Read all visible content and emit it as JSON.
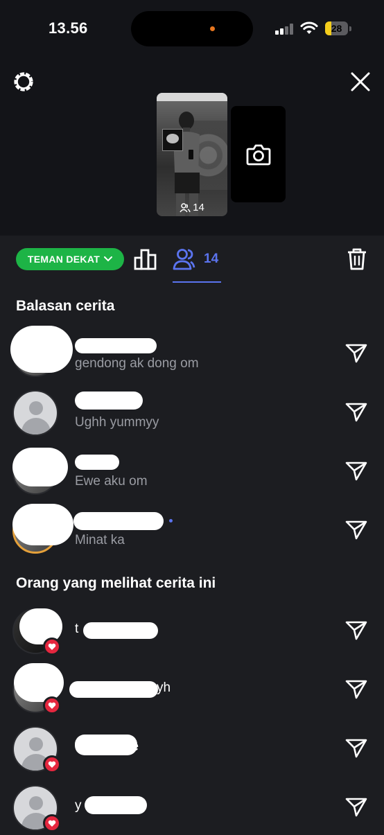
{
  "status_bar": {
    "time": "13.56",
    "battery": "28",
    "battery_level": 0.28
  },
  "story": {
    "viewer_count": "14",
    "thumbnail_icon": "viewers-icon",
    "add_story_icon": "camera-icon"
  },
  "toolbar": {
    "audience_label": "TEMAN DEKAT",
    "viewers_count": "14",
    "colors": {
      "pill": "#1db446",
      "accent": "#5b74f0",
      "like": "#e5273f"
    }
  },
  "replies": {
    "title": "Balasan cerita",
    "items": [
      {
        "name": "",
        "message": "gendong ak dong om"
      },
      {
        "name": "",
        "message": "Ughh yummyy"
      },
      {
        "name": "",
        "message": "Ewe aku om"
      },
      {
        "name": "",
        "message": "Minat ka"
      }
    ]
  },
  "viewers": {
    "title": "Orang yang melihat cerita ini",
    "items": [
      {
        "name": "t"
      },
      {
        "name": "yh"
      },
      {
        "name": "ce"
      },
      {
        "name": "y      ahh"
      }
    ]
  }
}
